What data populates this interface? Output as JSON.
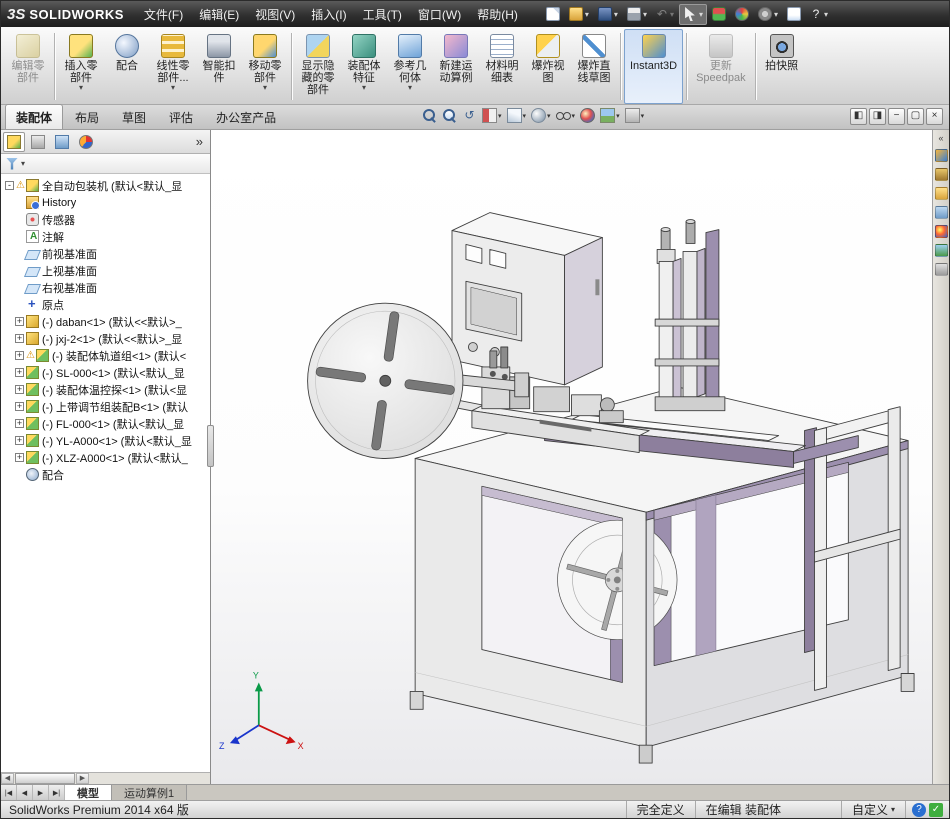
{
  "window": {
    "logo_prefix": "3S",
    "logo_text": "SOLIDWORKS"
  },
  "menu_bar": {
    "items": [
      "文件(F)",
      "编辑(E)",
      "视图(V)",
      "插入(I)",
      "工具(T)",
      "窗口(W)",
      "帮助(H)"
    ]
  },
  "quick_access_toolbar": {
    "buttons": [
      {
        "name": "new-file",
        "icon": "new-file-icon"
      },
      {
        "name": "open-file",
        "icon": "open-folder-icon",
        "dropdown": true
      },
      {
        "name": "save",
        "icon": "save-icon",
        "dropdown": true
      },
      {
        "name": "print",
        "icon": "print-icon",
        "dropdown": true
      },
      {
        "name": "undo",
        "icon": "undo-icon",
        "glyph": "↶",
        "dropdown": true,
        "disabled": true
      },
      {
        "name": "select",
        "icon": "select-arrow-icon",
        "dropdown": true,
        "pressed": true
      },
      {
        "name": "rebuild",
        "icon": "rebuild-icon"
      },
      {
        "name": "edit-appearance",
        "icon": "appearance-wheel-icon"
      },
      {
        "name": "options",
        "icon": "options-gear-icon",
        "dropdown": true
      },
      {
        "name": "file-properties",
        "icon": "file-properties-icon"
      },
      {
        "name": "help",
        "icon": "help-icon",
        "glyph": "?",
        "dropdown": true
      }
    ]
  },
  "ribbon": {
    "buttons": [
      {
        "id": "edit-component",
        "lines": [
          "编辑零",
          "部件"
        ],
        "disabled": true,
        "sep_after": true
      },
      {
        "id": "insert-components",
        "lines": [
          "插入零",
          "部件"
        ],
        "dropdown": true
      },
      {
        "id": "mate",
        "lines": [
          "配合"
        ]
      },
      {
        "id": "linear-component-pattern",
        "lines": [
          "线性零",
          "部件..."
        ],
        "dropdown": true
      },
      {
        "id": "smart-fasteners",
        "lines": [
          "智能扣",
          "件"
        ]
      },
      {
        "id": "move-component",
        "lines": [
          "移动零",
          "部件"
        ],
        "dropdown": true,
        "sep_after": true
      },
      {
        "id": "show-hidden-components",
        "lines": [
          "显示隐",
          "藏的零",
          "部件"
        ]
      },
      {
        "id": "assembly-features",
        "lines": [
          "装配体",
          "特征"
        ],
        "dropdown": true
      },
      {
        "id": "reference-geometry",
        "lines": [
          "参考几",
          "何体"
        ],
        "dropdown": true
      },
      {
        "id": "new-motion-study",
        "lines": [
          "新建运",
          "动算例"
        ]
      },
      {
        "id": "bill-of-materials",
        "lines": [
          "材料明",
          "细表"
        ]
      },
      {
        "id": "exploded-view",
        "lines": [
          "爆炸视",
          "图"
        ]
      },
      {
        "id": "explode-line-sketch",
        "lines": [
          "爆炸直",
          "线草图"
        ],
        "sep_after": true
      },
      {
        "id": "instant3d",
        "lines": [
          "Instant3D"
        ],
        "pressed": true,
        "sep_after": true
      },
      {
        "id": "update-speedpak",
        "lines": [
          "更新",
          "Speedpak"
        ],
        "disabled": true,
        "sep_after": true
      },
      {
        "id": "take-snapshot",
        "lines": [
          "拍快照"
        ]
      }
    ]
  },
  "command_tabs": {
    "tabs": [
      {
        "label": "装配体",
        "active": true
      },
      {
        "label": "布局",
        "active": false
      },
      {
        "label": "草图",
        "active": false
      },
      {
        "label": "评估",
        "active": false
      },
      {
        "label": "办公室产品",
        "active": false
      }
    ]
  },
  "view_toolbar": {
    "buttons": [
      {
        "name": "zoom-fit",
        "icon": "zoom-fit-icon"
      },
      {
        "name": "zoom-area",
        "icon": "zoom-area-icon"
      },
      {
        "name": "previous-view",
        "icon": "previous-view-icon",
        "glyph": "↺"
      },
      {
        "name": "section-view",
        "icon": "section-view-icon",
        "dropdown": true
      },
      {
        "name": "view-orientation",
        "icon": "view-cube-icon",
        "dropdown": true
      },
      {
        "name": "display-style",
        "icon": "display-style-icon",
        "dropdown": true
      },
      {
        "name": "hide-show-items",
        "icon": "eye-glasses-icon",
        "dropdown": true
      },
      {
        "name": "edit-appearance",
        "icon": "appearance-ball-icon"
      },
      {
        "name": "apply-scene",
        "icon": "scene-icon",
        "dropdown": true
      },
      {
        "name": "view-settings",
        "icon": "view-settings-icon",
        "dropdown": true
      }
    ]
  },
  "window_controls": {
    "buttons": [
      {
        "name": "display-pane-left",
        "glyph": "◧"
      },
      {
        "name": "display-pane-right",
        "glyph": "◨"
      },
      {
        "name": "minimize",
        "glyph": "−"
      },
      {
        "name": "restore",
        "glyph": "▢"
      },
      {
        "name": "close",
        "glyph": "×"
      }
    ]
  },
  "feature_panel": {
    "tabs": [
      {
        "name": "featuremanager",
        "icon": "featuremanager-icon"
      },
      {
        "name": "propertymanager",
        "icon": "propertymanager-icon"
      },
      {
        "name": "configurationmanager",
        "icon": "configurationmanager-icon"
      },
      {
        "name": "displaymanager",
        "icon": "displaymanager-icon"
      }
    ],
    "chevron": "»",
    "tree": [
      {
        "icon": "assembly-icon",
        "label": "全自动包装机 (默认<默认_显",
        "warning": true,
        "level": 0,
        "expander": "minus"
      },
      {
        "icon": "history-icon",
        "label": "History",
        "level": 1
      },
      {
        "icon": "sensors-icon",
        "label": "传感器",
        "level": 1
      },
      {
        "icon": "annotations-icon",
        "label": "注解",
        "level": 1
      },
      {
        "icon": "plane-icon",
        "label": "前视基准面",
        "level": 1
      },
      {
        "icon": "plane-icon",
        "label": "上视基准面",
        "level": 1
      },
      {
        "icon": "plane-icon",
        "label": "右视基准面",
        "level": 1
      },
      {
        "icon": "origin-icon",
        "label": "原点",
        "level": 1
      },
      {
        "icon": "part-icon",
        "label": "(-) daban<1> (默认<<默认>_",
        "level": 1,
        "expander": "plus"
      },
      {
        "icon": "part-icon",
        "label": "(-) jxj-2<1> (默认<<默认>_显",
        "level": 1,
        "expander": "plus"
      },
      {
        "icon": "subassembly-icon",
        "label": "(-) 装配体轨道组<1> (默认<",
        "level": 1,
        "expander": "plus",
        "warning": true
      },
      {
        "icon": "subassembly-icon",
        "label": "(-) SL-000<1> (默认<默认_显",
        "level": 1,
        "expander": "plus"
      },
      {
        "icon": "subassembly-icon",
        "label": "(-) 装配体温控探<1> (默认<显",
        "level": 1,
        "expander": "plus"
      },
      {
        "icon": "subassembly-icon",
        "label": "(-) 上带调节组装配B<1> (默认",
        "level": 1,
        "expander": "plus"
      },
      {
        "icon": "subassembly-icon",
        "label": "(-) FL-000<1> (默认<默认_显",
        "level": 1,
        "expander": "plus"
      },
      {
        "icon": "subassembly-icon",
        "label": "(-) YL-A000<1> (默认<默认_显",
        "level": 1,
        "expander": "plus"
      },
      {
        "icon": "subassembly-icon",
        "label": "(-) XLZ-A000<1> (默认<默认_",
        "level": 1,
        "expander": "plus"
      },
      {
        "icon": "mates-icon",
        "label": "配合",
        "level": 1
      }
    ]
  },
  "viewport": {
    "triad": {
      "x_label": "X",
      "y_label": "Y",
      "z_label": "Z"
    }
  },
  "task_pane": {
    "icons": [
      "resources-icon",
      "design-library-icon",
      "file-explorer-icon",
      "view-palette-icon",
      "appearances-icon",
      "scenes-icon",
      "custom-properties-icon"
    ]
  },
  "sheet_bar": {
    "nav": [
      "|◀",
      "◀",
      "▶",
      "▶|"
    ],
    "tabs": [
      {
        "label": "模型",
        "active": true
      },
      {
        "label": "运动算例1",
        "active": false
      }
    ]
  },
  "status_bar": {
    "app_version": "SolidWorks Premium 2014 x64 版",
    "fields": [
      "完全定义",
      "在编辑 装配体"
    ],
    "custom_label": "自定义",
    "icons": [
      {
        "name": "help",
        "glyph": "?"
      },
      {
        "name": "status-check",
        "glyph": "✓"
      }
    ]
  }
}
